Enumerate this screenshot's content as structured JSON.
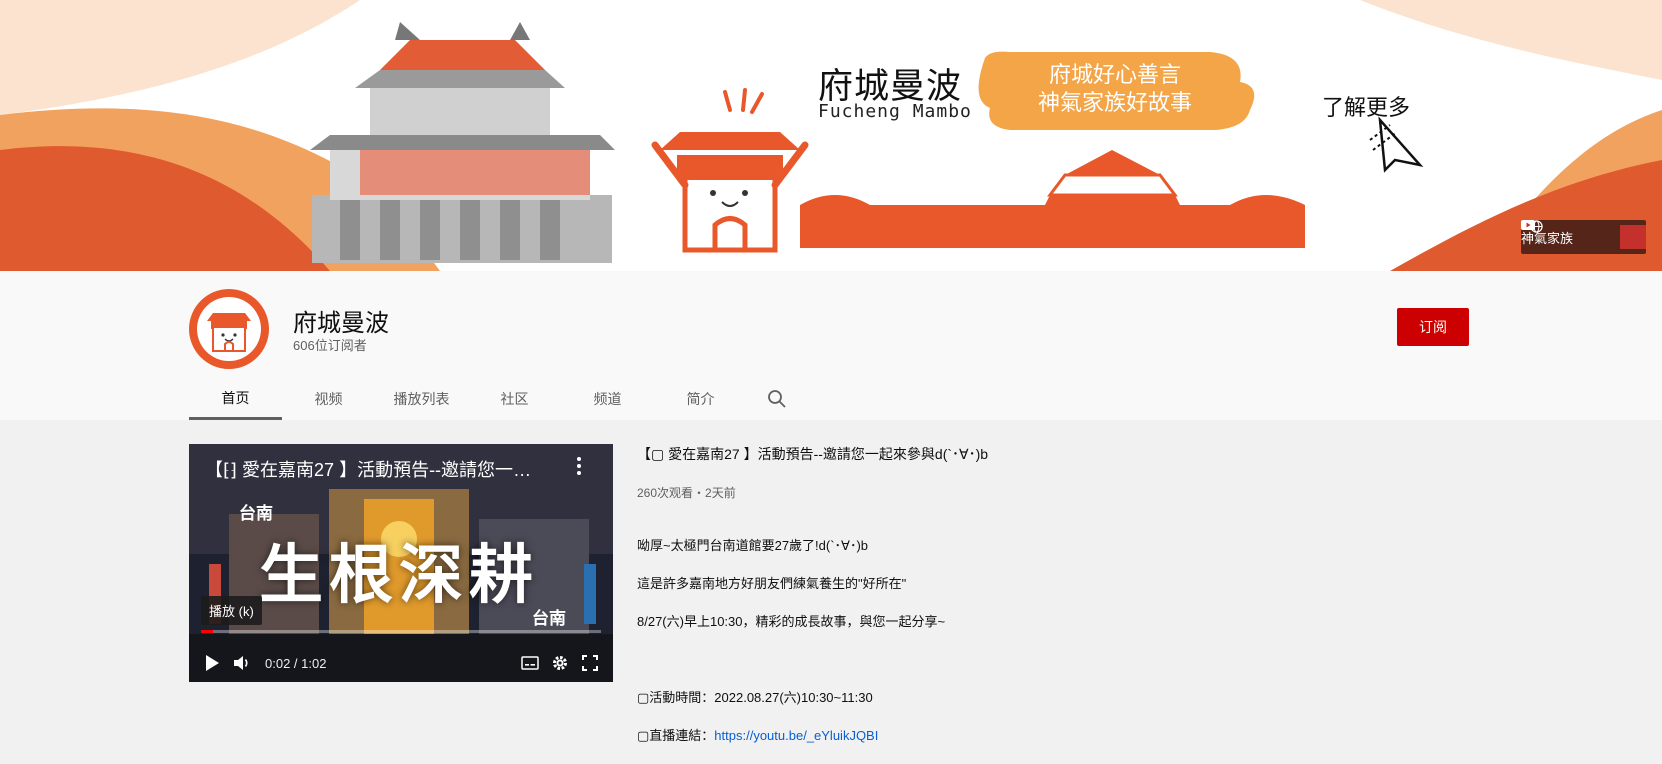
{
  "banner": {
    "title": "府城曼波",
    "subtitle": "Fucheng Mambo",
    "cloud_line1": "府城好心善言",
    "cloud_line2": "神氣家族好故事",
    "learn_more": "了解更多",
    "link_label": "神氣家族"
  },
  "channel": {
    "name": "府城曼波",
    "subscribers": "606位订阅者",
    "subscribe_label": "订阅"
  },
  "tabs": [
    {
      "label": "首页",
      "active": true
    },
    {
      "label": "视频"
    },
    {
      "label": "播放列表"
    },
    {
      "label": "社区"
    },
    {
      "label": "频道"
    },
    {
      "label": "简介"
    }
  ],
  "video": {
    "overlay_title": "【⁅⁆ 愛在嘉南27 】活動預告--邀請您一起...",
    "label_top": "台南",
    "label_bottom": "台南",
    "calligraphy": "生根深耕",
    "tooltip": "播放 (k)",
    "time": "0:02 / 1:02",
    "progress": 0.03
  },
  "info": {
    "title": "【▢ 愛在嘉南27 】活動預告--邀請您一起來參與d(`･∀･)b",
    "meta": "260次观看・2天前",
    "desc_lines": [
      "呦厚~太極門台南道館要27歲了!d(`･∀･)b",
      "這是許多嘉南地方好朋友們練氣養生的\"好所在\"",
      "8/27(六)早上10:30，精彩的成長故事，與您一起分享~",
      "",
      "▢活動時間：2022.08.27(六)10:30~11:30"
    ],
    "link_prefix": "▢直播連結：",
    "link_text": "https://youtu.be/_eYluikJQBI"
  },
  "colors": {
    "accent_orange": "#e8582a",
    "subscribe_red": "#cc0000",
    "link_blue": "#065fd4"
  }
}
